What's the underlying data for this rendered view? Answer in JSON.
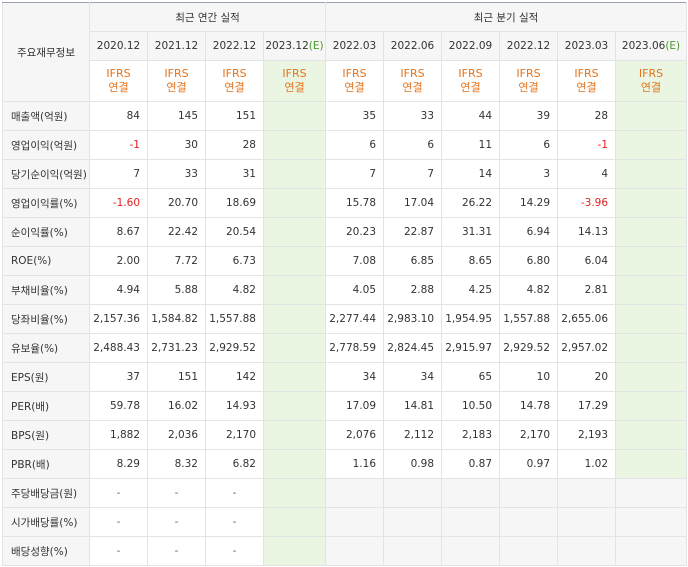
{
  "header": {
    "row_label": "주요재무정보",
    "annual_group": "최근 연간 실적",
    "quarterly_group": "최근 분기 실적",
    "est_mark": "(E)"
  },
  "annual_periods": [
    "2020.12",
    "2021.12",
    "2022.12",
    "2023.12"
  ],
  "quarterly_periods": [
    "2022.03",
    "2022.06",
    "2022.09",
    "2022.12",
    "2023.03",
    "2023.06"
  ],
  "ifrs": {
    "line1": "IFRS",
    "line2": "연결"
  },
  "rows": [
    {
      "label": "매출액(억원)",
      "annual": [
        "84",
        "145",
        "151",
        ""
      ],
      "quarterly": [
        "35",
        "33",
        "44",
        "39",
        "28",
        ""
      ]
    },
    {
      "label": "영업이익(억원)",
      "annual": [
        "-1",
        "30",
        "28",
        ""
      ],
      "quarterly": [
        "6",
        "6",
        "11",
        "6",
        "-1",
        ""
      ]
    },
    {
      "label": "당기순이익(억원)",
      "annual": [
        "7",
        "33",
        "31",
        ""
      ],
      "quarterly": [
        "7",
        "7",
        "14",
        "3",
        "4",
        ""
      ]
    },
    {
      "label": "영업이익률(%)",
      "annual": [
        "-1.60",
        "20.70",
        "18.69",
        ""
      ],
      "quarterly": [
        "15.78",
        "17.04",
        "26.22",
        "14.29",
        "-3.96",
        ""
      ]
    },
    {
      "label": "순이익률(%)",
      "annual": [
        "8.67",
        "22.42",
        "20.54",
        ""
      ],
      "quarterly": [
        "20.23",
        "22.87",
        "31.31",
        "6.94",
        "14.13",
        ""
      ]
    },
    {
      "label": "ROE(%)",
      "annual": [
        "2.00",
        "7.72",
        "6.73",
        ""
      ],
      "quarterly": [
        "7.08",
        "6.85",
        "8.65",
        "6.80",
        "6.04",
        ""
      ]
    },
    {
      "label": "부채비율(%)",
      "annual": [
        "4.94",
        "5.88",
        "4.82",
        ""
      ],
      "quarterly": [
        "4.05",
        "2.88",
        "4.25",
        "4.82",
        "2.81",
        ""
      ]
    },
    {
      "label": "당좌비율(%)",
      "annual": [
        "2,157.36",
        "1,584.82",
        "1,557.88",
        ""
      ],
      "quarterly": [
        "2,277.44",
        "2,983.10",
        "1,954.95",
        "1,557.88",
        "2,655.06",
        ""
      ]
    },
    {
      "label": "유보율(%)",
      "annual": [
        "2,488.43",
        "2,731.23",
        "2,929.52",
        ""
      ],
      "quarterly": [
        "2,778.59",
        "2,824.45",
        "2,915.97",
        "2,929.52",
        "2,957.02",
        ""
      ]
    },
    {
      "label": "EPS(원)",
      "annual": [
        "37",
        "151",
        "142",
        ""
      ],
      "quarterly": [
        "34",
        "34",
        "65",
        "10",
        "20",
        ""
      ]
    },
    {
      "label": "PER(배)",
      "annual": [
        "59.78",
        "16.02",
        "14.93",
        ""
      ],
      "quarterly": [
        "17.09",
        "14.81",
        "10.50",
        "14.78",
        "17.29",
        ""
      ]
    },
    {
      "label": "BPS(원)",
      "annual": [
        "1,882",
        "2,036",
        "2,170",
        ""
      ],
      "quarterly": [
        "2,076",
        "2,112",
        "2,183",
        "2,170",
        "2,193",
        ""
      ]
    },
    {
      "label": "PBR(배)",
      "annual": [
        "8.29",
        "8.32",
        "6.82",
        ""
      ],
      "quarterly": [
        "1.16",
        "0.98",
        "0.87",
        "0.97",
        "1.02",
        ""
      ]
    },
    {
      "label": "주당배당금(원)",
      "annual": [
        "-",
        "-",
        "-",
        ""
      ],
      "quarterly": [
        "",
        "",
        "",
        "",
        "",
        ""
      ]
    },
    {
      "label": "시가배당률(%)",
      "annual": [
        "-",
        "-",
        "-",
        ""
      ],
      "quarterly": [
        "",
        "",
        "",
        "",
        "",
        ""
      ]
    },
    {
      "label": "배당성향(%)",
      "annual": [
        "-",
        "-",
        "-",
        ""
      ],
      "quarterly": [
        "",
        "",
        "",
        "",
        "",
        ""
      ]
    }
  ],
  "colors": {
    "negative": "#dd2222",
    "ifrs": "#e5731a",
    "estimate_bg": "#eaf5e2",
    "estimate_mark": "#4a9a2a"
  }
}
